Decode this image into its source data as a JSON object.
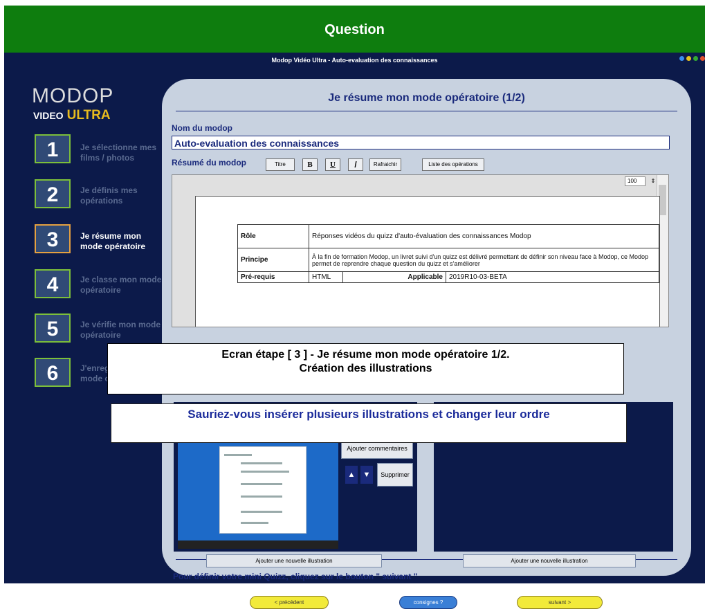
{
  "header": {
    "title": "Question"
  },
  "app": {
    "title": "Modop Vidéo Ultra - Auto-evaluation des connaissances",
    "dots": [
      "#3a8ef0",
      "#e8c020",
      "#33aa33",
      "#e05030"
    ]
  },
  "logo": {
    "line1": "MODOP",
    "video": "VIDEO",
    "ultra": "ULTRA"
  },
  "steps": [
    {
      "num": "1",
      "label": "Je sélectionne mes films / photos"
    },
    {
      "num": "2",
      "label": "Je définis mes opérations"
    },
    {
      "num": "3",
      "label": "Je résume mon mode opératoire"
    },
    {
      "num": "4",
      "label": "Je classe mon mode opératoire"
    },
    {
      "num": "5",
      "label": "Je vérifie mon mode opératoire"
    },
    {
      "num": "6",
      "label": "J'enregistre mon mode opératoire"
    }
  ],
  "panel": {
    "title": "Je résume mon mode opératoire (1/2)",
    "name_label": "Nom du modop",
    "name_value": "Auto-evaluation des connaissances",
    "summary_label": "Résumé du modop",
    "toolbar": {
      "titre": "Titre",
      "bold": "B",
      "underline": "U",
      "italic": "/",
      "refresh": "Rafraichir",
      "ops": "Liste des opérations"
    },
    "zoom": "100",
    "table": {
      "role_k": "Rôle",
      "role_v": "Réponses vidéos du quizz d'auto-évaluation des connaissances Modop",
      "principe_k": "Principe",
      "principe_v": "À la fin de formation Modop, un livret suivi d'un quizz est délivré permettant de définir son niveau face à Modop, ce Modop permet de reprendre chaque question du quizz et s'améliorer",
      "prereq_k": "Pré-requis",
      "prereq_v": "HTML",
      "applicable_k": "Applicable",
      "applicable_v": "2019R10-03-BETA"
    },
    "overlay1": {
      "line1": "Ecran étape [ 3 ] - Je résume mon mode opératoire 1/2.",
      "line2": "Création des illustrations"
    },
    "overlay2": "Sauriez-vous insérer plusieurs illustrations et changer leur ordre",
    "add_comments": "Ajouter commentaires",
    "delete": "Supprimer",
    "up": "▲",
    "down": "▼",
    "add_illustration_left": "Ajouter une nouvelle illustration",
    "add_illustration_right": "Ajouter une nouvelle illustration",
    "hint": "Pour définir votre mini Quizz, cliquez sur le bouton \" suivant \"",
    "prev": "< précédent",
    "instructions": "consignes ?",
    "next": "suivant >"
  }
}
